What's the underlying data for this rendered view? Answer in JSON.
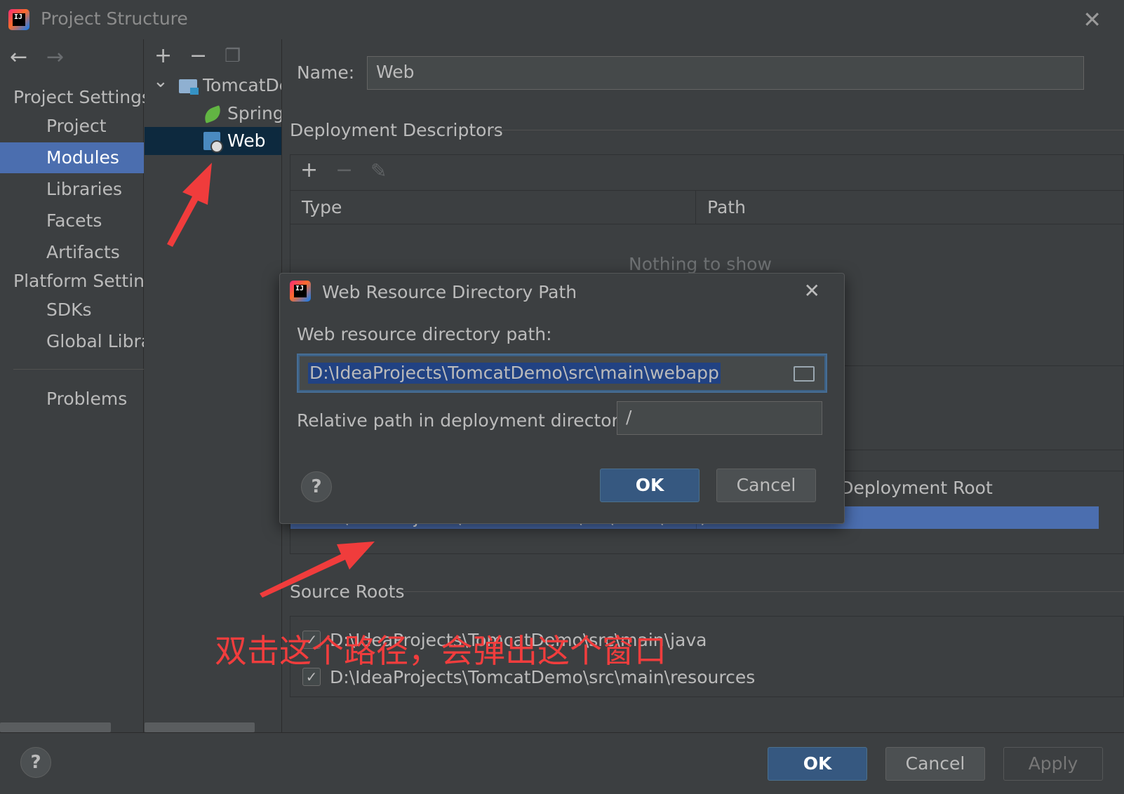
{
  "window": {
    "title": "Project Structure",
    "logo_text": "IJ",
    "close_icon": "✕"
  },
  "nav": {
    "back_icon": "←",
    "forward_icon": "→",
    "project_settings_header": "Project Settings",
    "project_items": [
      "Project",
      "Modules",
      "Libraries",
      "Facets",
      "Artifacts"
    ],
    "platform_settings_header": "Platform Settings",
    "platform_items": [
      "SDKs",
      "Global Libraries"
    ],
    "problems": "Problems",
    "selected": "Modules"
  },
  "tree": {
    "toolbar": {
      "add": "+",
      "remove": "−",
      "copy": "❐"
    },
    "expand_icon": "⌄",
    "root": "TomcatDemo",
    "children": [
      "Spring",
      "Web"
    ],
    "selected": "Web"
  },
  "main": {
    "name_label": "Name:",
    "name_value": "Web",
    "deployment_descriptors": "Deployment Descriptors",
    "dd_toolbar": {
      "add": "+",
      "remove": "−",
      "edit": "✎"
    },
    "dd_columns": [
      "Type",
      "Path"
    ],
    "dd_empty": "Nothing to show",
    "web_root_column_partial": "o Deployment Root",
    "web_root_row": {
      "path": "D:\\IdeaProjects\\TomcatDemo\\src\\main\\we...",
      "relative": "/"
    },
    "source_roots": "Source Roots",
    "source_root_items": [
      {
        "path": "D:\\IdeaProjects\\TomcatDemo\\src\\main\\java",
        "checked": true
      },
      {
        "path": "D:\\IdeaProjects\\TomcatDemo\\src\\main\\resources",
        "checked": true
      }
    ]
  },
  "footer": {
    "help": "?",
    "ok": "OK",
    "cancel": "Cancel",
    "apply": "Apply"
  },
  "dialog": {
    "title": "Web Resource Directory Path",
    "close_icon": "✕",
    "path_label": "Web resource directory path:",
    "path_value": "D:\\IdeaProjects\\TomcatDemo\\src\\main\\webapp",
    "relative_label": "Relative path in deployment directory:",
    "relative_value": "/",
    "help": "?",
    "ok": "OK",
    "cancel": "Cancel"
  },
  "annotation": {
    "text": "双击这个路径，会弹出这个窗口",
    "color": "#f13d3d"
  },
  "colors": {
    "selection": "#4b6eaf",
    "primary_button": "#365880",
    "tree_selection": "#0d293e"
  }
}
